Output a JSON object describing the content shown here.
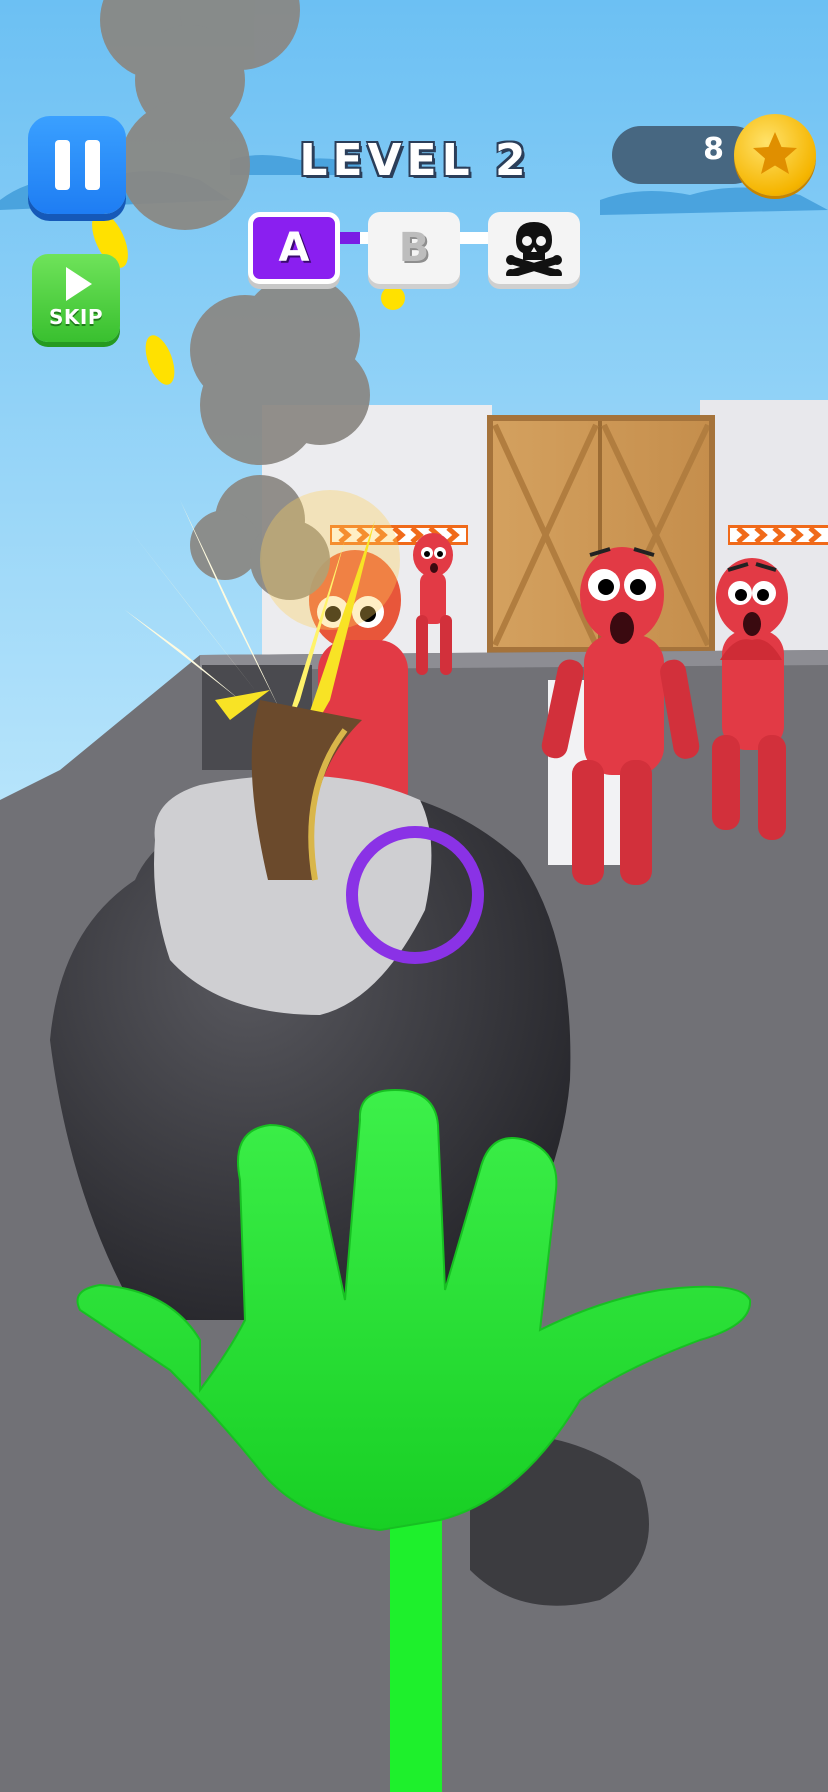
{
  "hud": {
    "level_title": "LEVEL 2",
    "skip_label": "SKIP",
    "coins": "8",
    "stages": [
      {
        "label": "A",
        "state": "current"
      },
      {
        "label": "B",
        "state": "locked"
      },
      {
        "label": "",
        "icon": "skull-crossbones-icon",
        "state": "boss"
      }
    ]
  },
  "colors": {
    "pause_button": "#1e7df3",
    "skip_button": "#39c02f",
    "stage_active": "#8a1ff0",
    "coin": "#f5b500",
    "hand": "#22e02f",
    "enemy": "#e23a45",
    "bomb": "#3a3a40"
  },
  "icons": [
    "pause-icon",
    "play-icon",
    "skull-crossbones-icon",
    "star-icon"
  ]
}
